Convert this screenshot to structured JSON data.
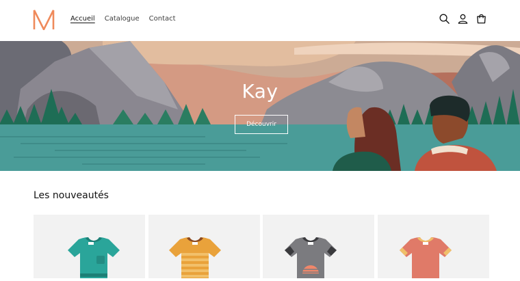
{
  "brand": {
    "logo_alt": "NM",
    "logo_color": "#ef8a5b"
  },
  "nav": {
    "items": [
      {
        "label": "Accueil",
        "active": true
      },
      {
        "label": "Catalogue",
        "active": false
      },
      {
        "label": "Contact",
        "active": false
      }
    ]
  },
  "header_icons": [
    "search-icon",
    "account-icon",
    "cart-icon"
  ],
  "hero": {
    "title": "Kay",
    "button_label": "Découvrir"
  },
  "featured": {
    "title": "Les nouveautés",
    "products": [
      {
        "image": "teal-tshirt-with-pocket",
        "color": "#2aa59a"
      },
      {
        "image": "orange-striped-tshirt",
        "color": "#e9a23b"
      },
      {
        "image": "grey-tshirt-sunset-print",
        "color": "#7b7b7f"
      },
      {
        "image": "coral-tshirt-yellow-trim",
        "color": "#e07a68"
      }
    ]
  }
}
